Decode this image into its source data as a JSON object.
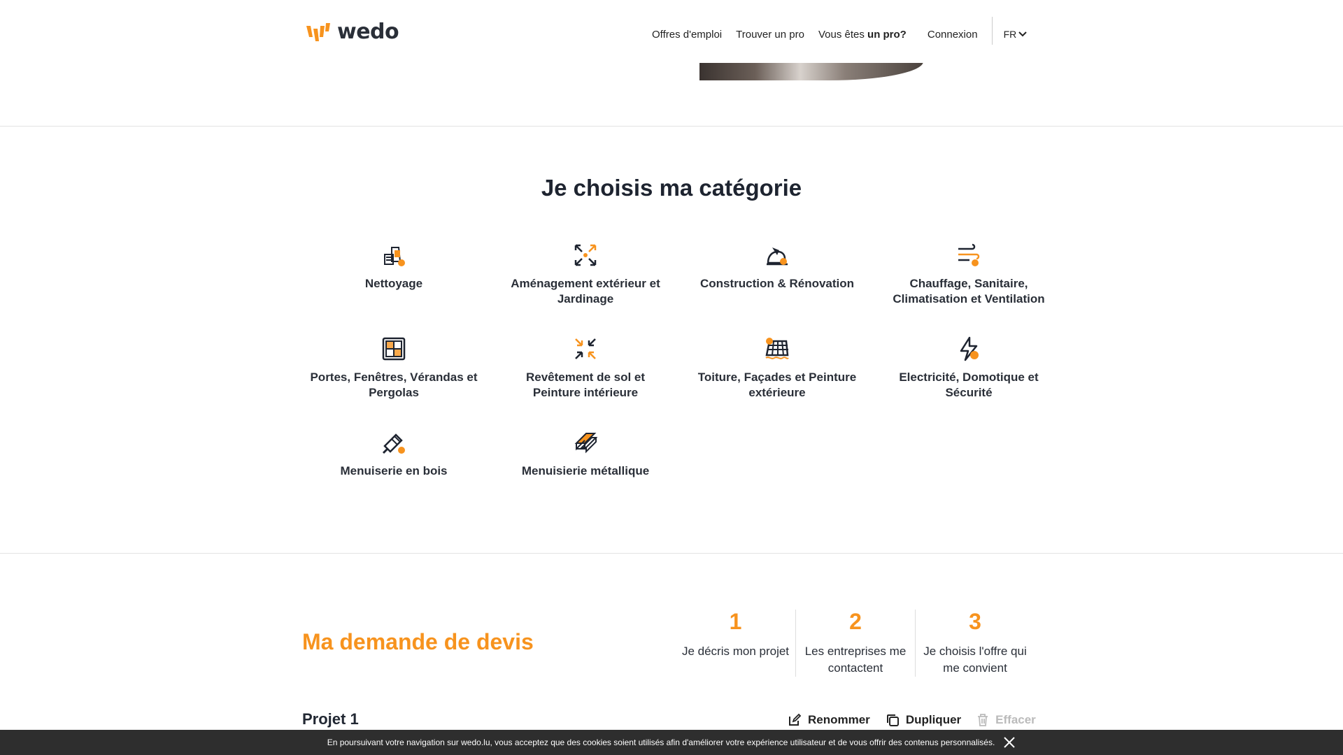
{
  "header": {
    "logo_text": "wedo",
    "nav": {
      "jobs": "Offres d'emploi",
      "find_pro": "Trouver un pro",
      "are_you_prefix": "Vous êtes ",
      "are_you_bold": "un pro?",
      "login": "Connexion",
      "lang": "FR"
    }
  },
  "categories": {
    "title": "Je choisis ma catégorie",
    "items": [
      {
        "label": "Nettoyage",
        "icon": "cleaning-icon"
      },
      {
        "label": "Aménagement extérieur et Jardinage",
        "icon": "landscaping-icon"
      },
      {
        "label": "Construction & Rénovation",
        "icon": "construction-icon"
      },
      {
        "label": "Chauffage, Sanitaire, Climatisation et Ventilation",
        "icon": "hvac-icon"
      },
      {
        "label": "Portes, Fenêtres, Vérandas et Pergolas",
        "icon": "window-icon"
      },
      {
        "label": "Revêtement de sol et Peinture intérieure",
        "icon": "flooring-icon"
      },
      {
        "label": "Toiture, Façades et Peinture extérieure",
        "icon": "roofing-icon"
      },
      {
        "label": "Electricité, Domotique et Sécurité",
        "icon": "electricity-icon"
      },
      {
        "label": "Menuiserie en bois",
        "icon": "wood-carpentry-icon"
      },
      {
        "label": "Menuisierie métallique",
        "icon": "metal-carpentry-icon"
      }
    ]
  },
  "devis": {
    "title": "Ma demande de devis",
    "steps": [
      {
        "num": "1",
        "text": "Je décris mon projet"
      },
      {
        "num": "2",
        "text": "Les entreprises me contactent"
      },
      {
        "num": "3",
        "text": "Je choisis l'offre qui me convient"
      }
    ],
    "project_name": "Projet 1",
    "actions": {
      "rename": "Renommer",
      "duplicate": "Dupliquer",
      "delete": "Effacer"
    }
  },
  "cookie": {
    "text": "En poursuivant votre navigation sur wedo.lu, vous acceptez que des cookies soient utilisés afin d'améliorer votre expérience utilisateur et de vous offrir des contenus personnalisés."
  },
  "colors": {
    "accent": "#f7931e",
    "text": "#222833",
    "cookie_bg": "#2e2e2e"
  }
}
